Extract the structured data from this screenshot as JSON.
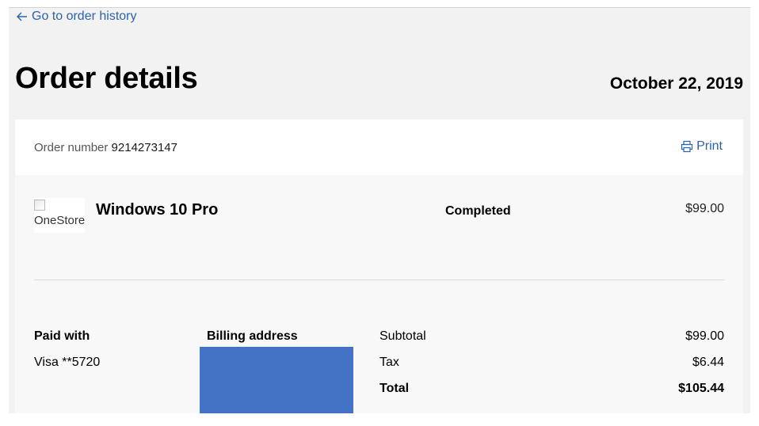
{
  "nav": {
    "back_label": "Go to order history"
  },
  "header": {
    "title": "Order details",
    "date": "October 22, 2019"
  },
  "order": {
    "number_label": "Order number",
    "number": "9214273147",
    "print_label": "Print"
  },
  "item": {
    "image_alt": "OneStore",
    "name": "Windows 10 Pro",
    "status": "Completed",
    "price": "$99.00"
  },
  "payment": {
    "paid_with_label": "Paid with",
    "method": "Visa **5720",
    "billing_label": "Billing address"
  },
  "summary": {
    "subtotal_label": "Subtotal",
    "subtotal": "$99.00",
    "tax_label": "Tax",
    "tax": "$6.44",
    "total_label": "Total",
    "total": "$105.44"
  },
  "colors": {
    "link": "#2a63ad",
    "redaction": "#4472c4",
    "page_bg": "#f2f2f2"
  }
}
